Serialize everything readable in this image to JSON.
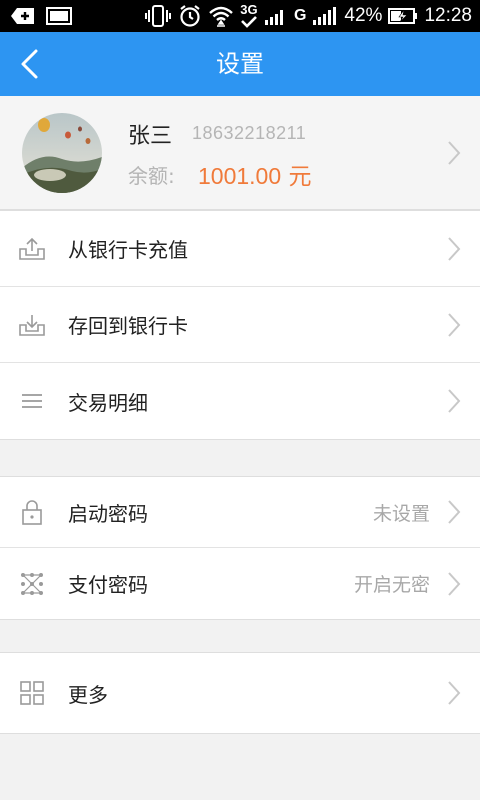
{
  "status_bar": {
    "network": "3G",
    "signal_g": "G",
    "battery": "42%",
    "time": "12:28"
  },
  "header": {
    "title": "设置"
  },
  "profile": {
    "name": "张三",
    "phone": "18632218211",
    "balance_label": "余额:",
    "balance_value": "1001.00",
    "balance_unit": "元"
  },
  "account_menu": [
    {
      "label": "从银行卡充值",
      "icon": "upload-tray-icon"
    },
    {
      "label": "存回到银行卡",
      "icon": "download-tray-icon"
    },
    {
      "label": "交易明细",
      "icon": "list-icon"
    }
  ],
  "security_menu": [
    {
      "label": "启动密码",
      "value": "未设置",
      "icon": "lock-icon"
    },
    {
      "label": "支付密码",
      "value": "开启无密",
      "icon": "pattern-icon"
    }
  ],
  "more_menu": [
    {
      "label": "更多",
      "icon": "grid-icon"
    }
  ],
  "colors": {
    "header": "#2d95f2",
    "balance": "#f07a3a",
    "background": "#f2f2f2"
  }
}
